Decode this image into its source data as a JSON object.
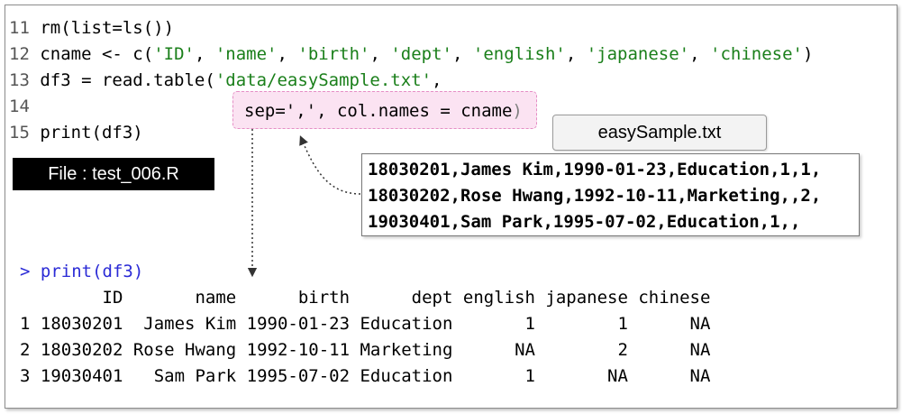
{
  "code": {
    "l11": {
      "num": "11",
      "a": "rm(list=ls())"
    },
    "l12": {
      "num": "12",
      "pre": "cname <- c(",
      "items": [
        "'ID'",
        "'name'",
        "'birth'",
        "'dept'",
        "'english'",
        "'japanese'",
        "'chinese'"
      ],
      "sep": ", ",
      "post": ")"
    },
    "l13": {
      "num": "13",
      "pre": "df3 = read.table(",
      "str": "'data/easySample.txt'",
      "post": ","
    },
    "l14": {
      "num": "14",
      "sep_call": "sep=',', col.names = cname",
      "tail": ")"
    },
    "l15": {
      "num": "15",
      "a": "print(df3)"
    }
  },
  "file_label": "File : test_006.R",
  "txt_title": "easySample.txt",
  "txt_lines": [
    "18030201,James Kim,1990-01-23,Education,1,1,",
    "18030202,Rose Hwang,1992-10-11,Marketing,,2,",
    "19030401,Sam Park,1995-07-02,Education,1,,"
  ],
  "console": {
    "prompt": "> print(df3)",
    "header": "        ID       name      birth      dept english japanese chinese",
    "rows": [
      "1 18030201  James Kim 1990-01-23 Education       1        1      NA",
      "2 18030202 Rose Hwang 1992-10-11 Marketing      NA        2      NA",
      "3 19030401   Sam Park 1995-07-02 Education       1       NA      NA"
    ]
  }
}
